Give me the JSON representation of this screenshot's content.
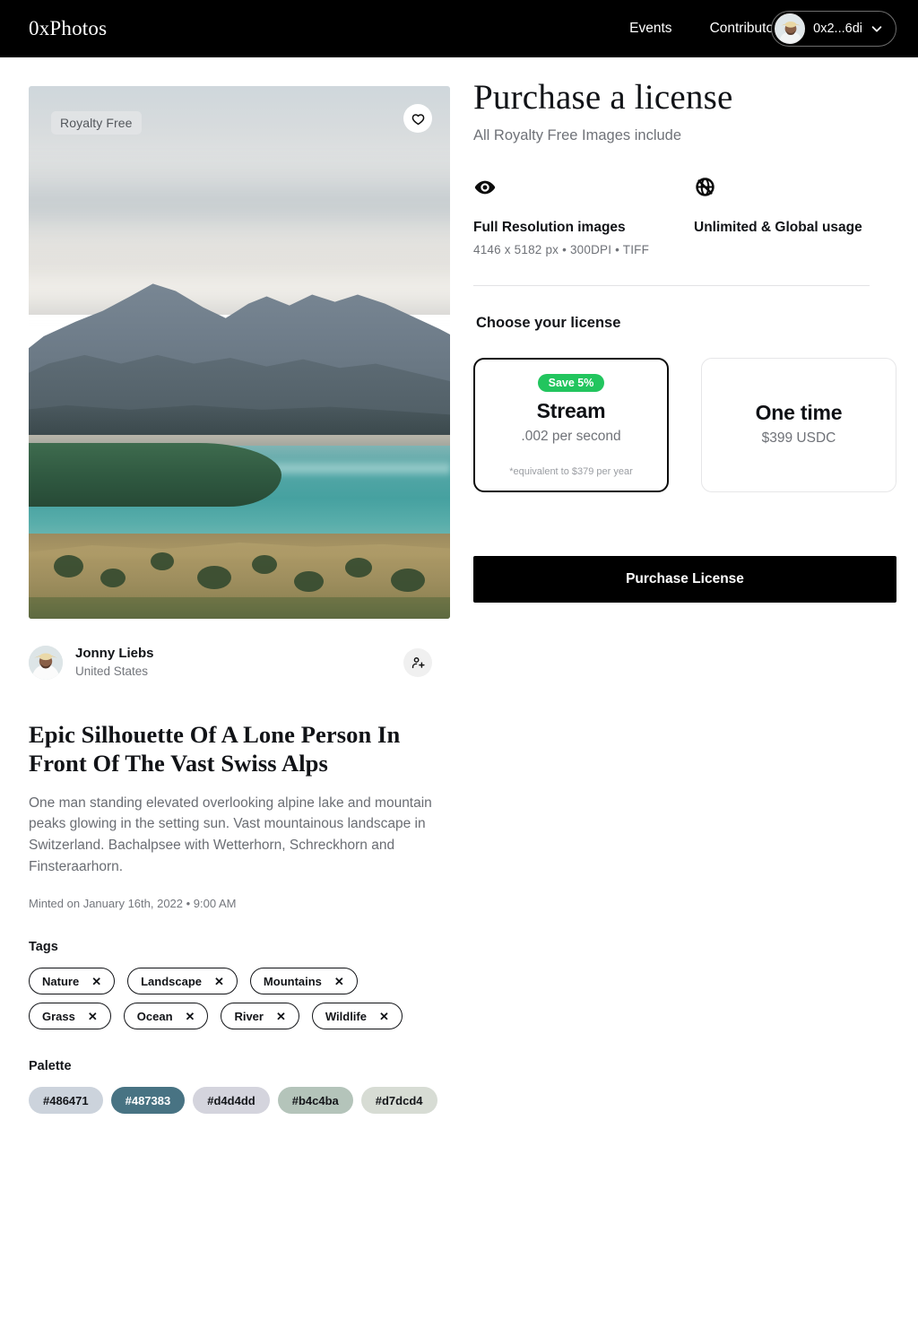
{
  "header": {
    "brand": "0xPhotos",
    "nav": [
      {
        "label": "Events",
        "name": "nav-events"
      },
      {
        "label": "Contributors",
        "name": "nav-contributors"
      }
    ],
    "wallet": {
      "address": "0x2...6di",
      "chevron_icon": "chevron-down-icon",
      "avatar_icon": "user-avatar"
    }
  },
  "photo": {
    "badge": "Royalty Free",
    "favorite_icon": "heart-icon",
    "alt": "Alpine lake with mountains and grassy foreground"
  },
  "author": {
    "name": "Jonny Liebs",
    "location": "United States",
    "follow_icon": "person-add-icon"
  },
  "details": {
    "title": "Epic Silhouette Of A Lone Person In Front Of The Vast Swiss Alps",
    "description": "One man standing elevated overlooking alpine lake and mountain peaks glowing in the setting sun. Vast mountainous landscape in Switzerland. Bachalpsee with Wetterhorn, Schreckhorn and Finsteraarhorn.",
    "minted": "Minted on January 16th, 2022 • 9:00 AM"
  },
  "tags": {
    "label": "Tags",
    "items": [
      {
        "label": "Nature",
        "remove_icon": "close-icon"
      },
      {
        "label": "Landscape",
        "remove_icon": "close-icon"
      },
      {
        "label": "Mountains",
        "remove_icon": "close-icon"
      },
      {
        "label": "Grass",
        "remove_icon": "close-icon"
      },
      {
        "label": "Ocean",
        "remove_icon": "close-icon"
      },
      {
        "label": "River",
        "remove_icon": "close-icon"
      },
      {
        "label": "Wildlife",
        "remove_icon": "close-icon"
      }
    ]
  },
  "palette": {
    "label": "Palette",
    "items": [
      {
        "label": "#486471",
        "chip_bg": "#ccd3dc",
        "text_color": "#14161a"
      },
      {
        "label": "#487383",
        "chip_bg": "#487383",
        "text_color": "#ffffff"
      },
      {
        "label": "#d4d4dd",
        "chip_bg": "#d4d4dd",
        "text_color": "#14161a"
      },
      {
        "label": "#b4c4ba",
        "chip_bg": "#b4c4ba",
        "text_color": "#14161a"
      },
      {
        "label": "#d7dcd4",
        "chip_bg": "#d7dcd4",
        "text_color": "#14161a"
      }
    ]
  },
  "purchase": {
    "title": "Purchase a license",
    "subtitle": "All Royalty Free Images include",
    "features": [
      {
        "icon": "eye-icon",
        "title": "Full Resolution images",
        "sub": "4146 x 5182 px  •   300DPI  •   TIFF"
      },
      {
        "icon": "globe-unlimited-icon",
        "title": "Unlimited & Global usage",
        "sub": ""
      }
    ],
    "choose_label": "Choose your license",
    "options": [
      {
        "badge": "Save 5%",
        "badge_color": "#22c55e",
        "title": "Stream",
        "price": ".002 per second",
        "note": "*equivalent to $379 per year",
        "selected": true
      },
      {
        "badge": "",
        "title": "One time",
        "price": "$399 USDC",
        "note": "",
        "selected": false
      }
    ],
    "cta": "Purchase License"
  }
}
